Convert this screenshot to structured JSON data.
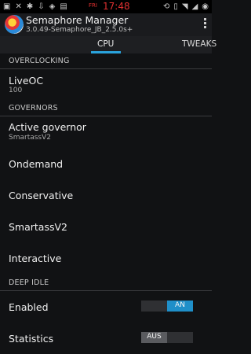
{
  "statusbar": {
    "time": "17:48",
    "battery_label": "FRI"
  },
  "app": {
    "title": "Semaphore Manager",
    "subtitle": "3.0.49-Semaphore_JB_2.5.0s+"
  },
  "tabs": [
    {
      "label": "CPU"
    },
    {
      "label": "TWEAKS"
    }
  ],
  "sections": {
    "overclocking": "OVERCLOCKING",
    "governors": "GOVERNORS",
    "deep_idle": "DEEP IDLE"
  },
  "liveoc": {
    "title": "LiveOC",
    "value": "100"
  },
  "active_governor": {
    "title": "Active governor",
    "value": "SmartassV2"
  },
  "governor_items": [
    {
      "label": "Ondemand"
    },
    {
      "label": "Conservative"
    },
    {
      "label": "SmartassV2"
    },
    {
      "label": "Interactive"
    }
  ],
  "deep_idle": {
    "enabled": {
      "label": "Enabled",
      "toggle_text": "AN",
      "state": true
    },
    "statistics": {
      "label": "Statistics",
      "toggle_text": "AUS",
      "state": false
    }
  },
  "colors": {
    "accent": "#2aa3dc",
    "toggle_on": "#1f8fc9"
  }
}
